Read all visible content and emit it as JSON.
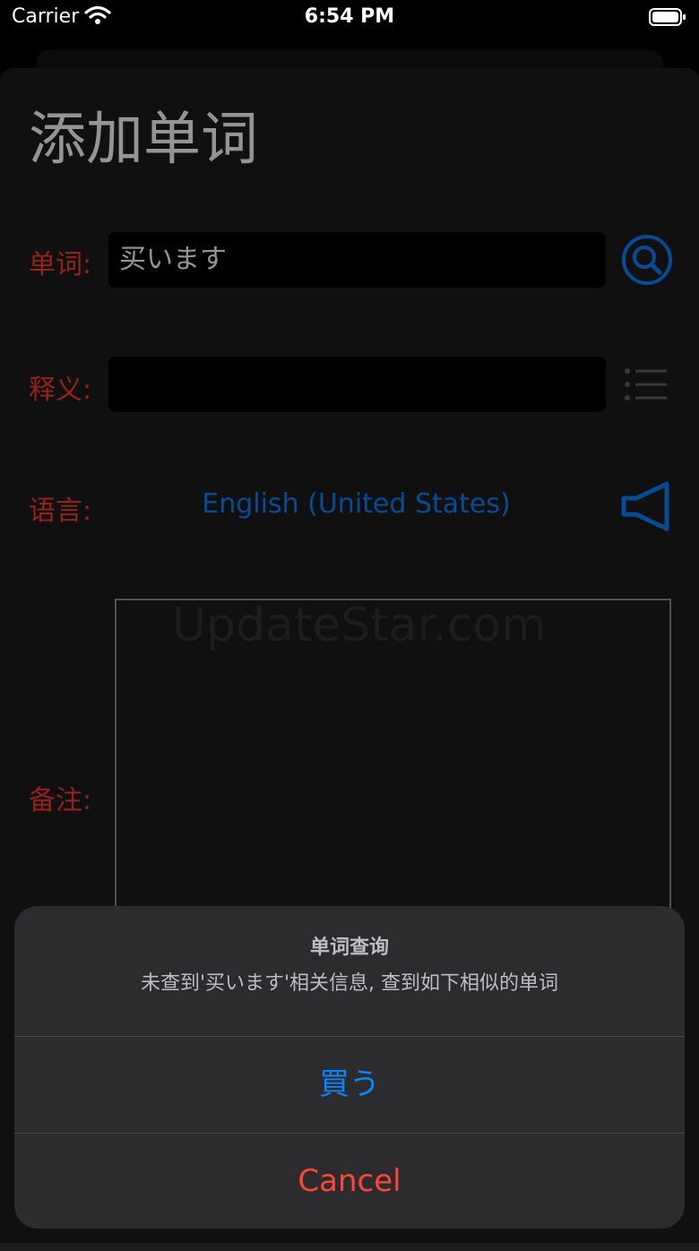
{
  "status_bar": {
    "carrier": "Carrier",
    "time": "6:54 PM"
  },
  "page": {
    "title": "添加单词"
  },
  "form": {
    "word_label": "单词:",
    "word_value": "买います",
    "definition_label": "释义:",
    "definition_value": "",
    "language_label": "语言:",
    "language_value": "English (United States)",
    "notes_label": "备注:"
  },
  "watermark": "UpdateStar.com",
  "alert": {
    "title": "单词查询",
    "message": "未查到'买います'相关信息, 查到如下相似的单词",
    "candidate": "買う",
    "cancel": "Cancel"
  },
  "colors": {
    "label": "#ff3b30",
    "accent": "#0a84ff",
    "destructive": "#ff453a"
  },
  "icons": [
    "wifi-icon",
    "battery-icon",
    "search-icon",
    "list-icon",
    "speaker-icon"
  ]
}
